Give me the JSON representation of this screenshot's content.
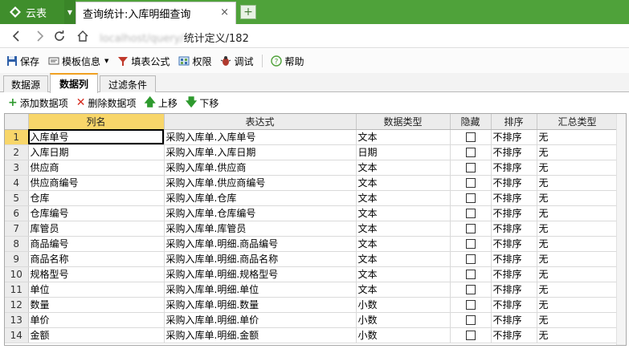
{
  "app": {
    "name": "云表",
    "brand_color": "#4fa23a"
  },
  "browser": {
    "tab_title": "查询统计:入库明细查询",
    "tab_close": "×",
    "new_tab": "+",
    "address_obscured": "localhost/query/",
    "address_visible": "统计定义/182"
  },
  "toolbar": {
    "save": "保存",
    "template_info": "模板信息",
    "formula": "填表公式",
    "permission": "权限",
    "debug": "调试",
    "help": "帮助"
  },
  "section_tabs": [
    "数据源",
    "数据列",
    "过滤条件"
  ],
  "actions": {
    "add": "添加数据项",
    "delete": "删除数据项",
    "up": "上移",
    "down": "下移"
  },
  "grid": {
    "columns": [
      "列名",
      "表达式",
      "数据类型",
      "隐藏",
      "排序",
      "汇总类型"
    ],
    "rows": [
      {
        "num": "1",
        "name": "入库单号",
        "expr": "采购入库单.入库单号",
        "type": "文本",
        "hidden": false,
        "sort": "不排序",
        "agg": "无"
      },
      {
        "num": "2",
        "name": "入库日期",
        "expr": "采购入库单.入库日期",
        "type": "日期",
        "hidden": false,
        "sort": "不排序",
        "agg": "无"
      },
      {
        "num": "3",
        "name": "供应商",
        "expr": "采购入库单.供应商",
        "type": "文本",
        "hidden": false,
        "sort": "不排序",
        "agg": "无"
      },
      {
        "num": "4",
        "name": "供应商编号",
        "expr": "采购入库单.供应商编号",
        "type": "文本",
        "hidden": false,
        "sort": "不排序",
        "agg": "无"
      },
      {
        "num": "5",
        "name": "仓库",
        "expr": "采购入库单.仓库",
        "type": "文本",
        "hidden": false,
        "sort": "不排序",
        "agg": "无"
      },
      {
        "num": "6",
        "name": "仓库编号",
        "expr": "采购入库单.仓库编号",
        "type": "文本",
        "hidden": false,
        "sort": "不排序",
        "agg": "无"
      },
      {
        "num": "7",
        "name": "库管员",
        "expr": "采购入库单.库管员",
        "type": "文本",
        "hidden": false,
        "sort": "不排序",
        "agg": "无"
      },
      {
        "num": "8",
        "name": "商品编号",
        "expr": "采购入库单.明细.商品编号",
        "type": "文本",
        "hidden": false,
        "sort": "不排序",
        "agg": "无"
      },
      {
        "num": "9",
        "name": "商品名称",
        "expr": "采购入库单.明细.商品名称",
        "type": "文本",
        "hidden": false,
        "sort": "不排序",
        "agg": "无"
      },
      {
        "num": "10",
        "name": "规格型号",
        "expr": "采购入库单.明细.规格型号",
        "type": "文本",
        "hidden": false,
        "sort": "不排序",
        "agg": "无"
      },
      {
        "num": "11",
        "name": "单位",
        "expr": "采购入库单.明细.单位",
        "type": "文本",
        "hidden": false,
        "sort": "不排序",
        "agg": "无"
      },
      {
        "num": "12",
        "name": "数量",
        "expr": "采购入库单.明细.数量",
        "type": "小数",
        "hidden": false,
        "sort": "不排序",
        "agg": "无"
      },
      {
        "num": "13",
        "name": "单价",
        "expr": "采购入库单.明细.单价",
        "type": "小数",
        "hidden": false,
        "sort": "不排序",
        "agg": "无"
      },
      {
        "num": "14",
        "name": "金额",
        "expr": "采购入库单.明细.金额",
        "type": "小数",
        "hidden": false,
        "sort": "不排序",
        "agg": "无"
      }
    ]
  },
  "icons": [
    "app-logo-icon",
    "menu-arrow-icon",
    "back-icon",
    "forward-icon",
    "refresh-icon",
    "home-icon",
    "save-icon",
    "template-icon",
    "formula-icon",
    "permission-icon",
    "debug-icon",
    "help-icon",
    "add-icon",
    "delete-icon",
    "up-arrow-icon",
    "down-arrow-icon"
  ]
}
